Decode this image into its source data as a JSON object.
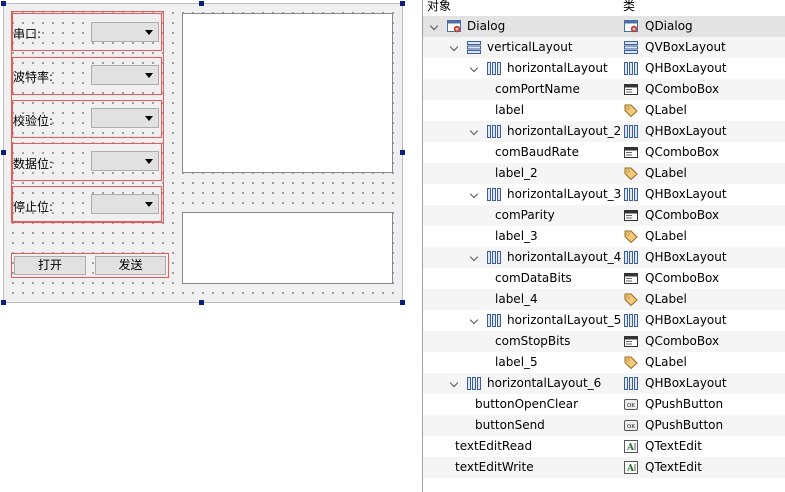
{
  "form": {
    "rows": [
      {
        "label": "串口:"
      },
      {
        "label": "波特率:"
      },
      {
        "label": "校验位:"
      },
      {
        "label": "数据位:"
      },
      {
        "label": "停止位:"
      }
    ],
    "buttons": {
      "open": "打开",
      "send": "发送"
    }
  },
  "inspector": {
    "headers": {
      "object": "对象",
      "class": "类"
    },
    "rows": [
      {
        "name": "Dialog",
        "cls": "QDialog",
        "icon": "dialog-icon",
        "cls_icon": "dialog-icon",
        "expander": true
      },
      {
        "name": "verticalLayout",
        "cls": "QVBoxLayout",
        "icon": "vbox-layout-icon",
        "cls_icon": "vbox-layout-icon",
        "expander": true
      },
      {
        "name": "horizontalLayout",
        "cls": "QHBoxLayout",
        "icon": "hbox-layout-icon",
        "cls_icon": "hbox-layout-icon",
        "expander": true
      },
      {
        "name": "comPortName",
        "cls": "QComboBox",
        "icon": "",
        "cls_icon": "combobox-icon",
        "expander": false
      },
      {
        "name": "label",
        "cls": "QLabel",
        "icon": "",
        "cls_icon": "label-tag-icon",
        "expander": false
      },
      {
        "name": "horizontalLayout_2",
        "cls": "QHBoxLayout",
        "icon": "hbox-layout-icon",
        "cls_icon": "hbox-layout-icon",
        "expander": true
      },
      {
        "name": "comBaudRate",
        "cls": "QComboBox",
        "icon": "",
        "cls_icon": "combobox-icon",
        "expander": false
      },
      {
        "name": "label_2",
        "cls": "QLabel",
        "icon": "",
        "cls_icon": "label-tag-icon",
        "expander": false
      },
      {
        "name": "horizontalLayout_3",
        "cls": "QHBoxLayout",
        "icon": "hbox-layout-icon",
        "cls_icon": "hbox-layout-icon",
        "expander": true
      },
      {
        "name": "comParity",
        "cls": "QComboBox",
        "icon": "",
        "cls_icon": "combobox-icon",
        "expander": false
      },
      {
        "name": "label_3",
        "cls": "QLabel",
        "icon": "",
        "cls_icon": "label-tag-icon",
        "expander": false
      },
      {
        "name": "horizontalLayout_4",
        "cls": "QHBoxLayout",
        "icon": "hbox-layout-icon",
        "cls_icon": "hbox-layout-icon",
        "expander": true
      },
      {
        "name": "comDataBits",
        "cls": "QComboBox",
        "icon": "",
        "cls_icon": "combobox-icon",
        "expander": false
      },
      {
        "name": "label_4",
        "cls": "QLabel",
        "icon": "",
        "cls_icon": "label-tag-icon",
        "expander": false
      },
      {
        "name": "horizontalLayout_5",
        "cls": "QHBoxLayout",
        "icon": "hbox-layout-icon",
        "cls_icon": "hbox-layout-icon",
        "expander": true
      },
      {
        "name": "comStopBits",
        "cls": "QComboBox",
        "icon": "",
        "cls_icon": "combobox-icon",
        "expander": false
      },
      {
        "name": "label_5",
        "cls": "QLabel",
        "icon": "",
        "cls_icon": "label-tag-icon",
        "expander": false
      },
      {
        "name": "horizontalLayout_6",
        "cls": "QHBoxLayout",
        "icon": "hbox-layout-icon",
        "cls_icon": "hbox-layout-icon",
        "expander": true
      },
      {
        "name": "buttonOpenClear",
        "cls": "QPushButton",
        "icon": "",
        "cls_icon": "pushbutton-icon",
        "expander": false
      },
      {
        "name": "buttonSend",
        "cls": "QPushButton",
        "icon": "",
        "cls_icon": "pushbutton-icon",
        "expander": false
      },
      {
        "name": "textEditRead",
        "cls": "QTextEdit",
        "icon": "",
        "cls_icon": "textedit-icon",
        "expander": false
      },
      {
        "name": "textEditWrite",
        "cls": "QTextEdit",
        "icon": "",
        "cls_icon": "textedit-icon",
        "expander": false
      }
    ]
  }
}
